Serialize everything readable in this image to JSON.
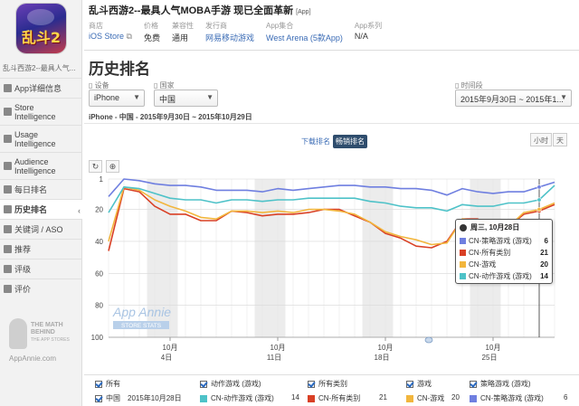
{
  "app": {
    "title": "乱斗西游2--最具人气MOBA手游 现已全面革新",
    "tag": "[App]",
    "icon_text": "乱斗2",
    "sidebar_name": "乱斗西游2--最具人气..."
  },
  "meta": [
    {
      "label": "商店",
      "value": "iOS Store",
      "link": true,
      "icon": "external-link-icon"
    },
    {
      "label": "价格",
      "value": "免费",
      "link": false
    },
    {
      "label": "兼容性",
      "value": "通用",
      "link": false
    },
    {
      "label": "发行商",
      "value": "网易移动游戏",
      "link": true
    },
    {
      "label": "App集合",
      "value": "West Arena (5款App)",
      "link": true
    },
    {
      "label": "App系列",
      "value": "N/A",
      "link": false
    }
  ],
  "nav": [
    {
      "label": "App详细信息",
      "icon": "info-icon"
    },
    {
      "label": "Store\nIntelligence",
      "icon": "store-icon",
      "tall": true
    },
    {
      "label": "Usage\nIntelligence",
      "icon": "usage-icon",
      "tall": true
    },
    {
      "label": "Audience\nIntelligence",
      "icon": "audience-icon",
      "tall": true
    },
    {
      "label": "每日排名",
      "icon": "list-icon"
    },
    {
      "label": "历史排名",
      "icon": "history-icon",
      "active": true
    },
    {
      "label": "关键词 / ASO",
      "icon": "key-icon"
    },
    {
      "label": "推荐",
      "icon": "feature-icon"
    },
    {
      "label": "评级",
      "icon": "star-icon"
    },
    {
      "label": "评价",
      "icon": "comment-icon"
    }
  ],
  "brand": {
    "line1": "THE MATH",
    "line2": "BEHIND",
    "line3": "THE APP STORES",
    "site": "AppAnnie.com"
  },
  "page_title": "历史排名",
  "filters": {
    "device_label": "设备",
    "device_value": "iPhone",
    "country_label": "国家",
    "country_value": "中国",
    "range_label": "时间段",
    "range_value": "2015年9月30日 ~ 2015年1..."
  },
  "subtitle": "iPhone - 中国 - 2015年9月30日 ~ 2015年10月29日",
  "rank_toggle": {
    "download": "下载排名",
    "grossing": "畅销排名"
  },
  "time_toggle": {
    "hour": "小时",
    "day": "天"
  },
  "tools": {
    "reset": "↻",
    "zoom": "⊕"
  },
  "watermark": {
    "name": "App Annie",
    "sub": "STORE STATS"
  },
  "chart_data": {
    "type": "line",
    "yaxis": {
      "ticks": [
        "1",
        "20",
        "40",
        "60",
        "80",
        "100"
      ],
      "reversed": true,
      "range": [
        1,
        100
      ]
    },
    "xaxis": {
      "ticks": [
        {
          "month": "10月",
          "day": "4日"
        },
        {
          "month": "10月",
          "day": "11日"
        },
        {
          "month": "10月",
          "day": "18日"
        },
        {
          "month": "10月",
          "day": "25日"
        }
      ]
    },
    "dates": [
      "9-30",
      "10-1",
      "10-2",
      "10-3",
      "10-4",
      "10-5",
      "10-6",
      "10-7",
      "10-8",
      "10-9",
      "10-10",
      "10-11",
      "10-12",
      "10-13",
      "10-14",
      "10-15",
      "10-16",
      "10-17",
      "10-18",
      "10-19",
      "10-20",
      "10-21",
      "10-22",
      "10-23",
      "10-24",
      "10-25",
      "10-26",
      "10-27",
      "10-28",
      "10-29"
    ],
    "series": [
      {
        "name": "CN-策略游戏 (游戏)",
        "color": "#6f7fe0",
        "values": [
          12,
          1,
          2,
          4,
          5,
          5,
          6,
          8,
          8,
          8,
          9,
          7,
          8,
          7,
          6,
          5,
          5,
          6,
          6,
          7,
          7,
          8,
          11,
          7,
          9,
          10,
          9,
          9,
          6,
          3
        ]
      },
      {
        "name": "CN-所有类别",
        "color": "#d94025",
        "values": [
          46,
          7,
          9,
          18,
          23,
          23,
          27,
          27,
          21,
          22,
          24,
          23,
          23,
          22,
          20,
          20,
          24,
          28,
          35,
          38,
          43,
          44,
          40,
          26,
          26,
          30,
          31,
          23,
          21,
          17
        ]
      },
      {
        "name": "CN-游戏",
        "color": "#f2b63d",
        "values": [
          40,
          6,
          8,
          14,
          18,
          21,
          25,
          26,
          21,
          21,
          22,
          21,
          22,
          20,
          20,
          21,
          23,
          28,
          34,
          37,
          39,
          42,
          41,
          26,
          27,
          29,
          31,
          22,
          20,
          16
        ]
      },
      {
        "name": "CN-动作游戏 (游戏)",
        "color": "#4ec2c8",
        "values": [
          22,
          6,
          7,
          10,
          13,
          14,
          14,
          16,
          14,
          14,
          15,
          14,
          14,
          13,
          13,
          13,
          13,
          15,
          16,
          18,
          19,
          19,
          21,
          17,
          18,
          18,
          16,
          16,
          14,
          5
        ]
      }
    ]
  },
  "tooltip": {
    "date": "周三, 10月28日",
    "rows": [
      {
        "name": "CN-策略游戏 (游戏)",
        "value": "6",
        "color": "#6f7fe0"
      },
      {
        "name": "CN-所有类别",
        "value": "21",
        "color": "#d94025"
      },
      {
        "name": "CN-游戏",
        "value": "20",
        "color": "#f2b63d"
      },
      {
        "name": "CN-动作游戏 (游戏)",
        "value": "14",
        "color": "#4ec2c8"
      }
    ]
  },
  "legend": {
    "header": [
      "所有",
      "动作游戏 (游戏)",
      "所有类别",
      "游戏",
      "策略游戏 (游戏)"
    ],
    "row_country": "中国",
    "row_date": "2015年10月28日",
    "items": [
      {
        "name": "CN-动作游戏 (游戏)",
        "value": "14",
        "color": "#4ec2c8"
      },
      {
        "name": "CN-所有类别",
        "value": "21",
        "color": "#d94025"
      },
      {
        "name": "CN-游戏",
        "value": "20",
        "color": "#f2b63d"
      },
      {
        "name": "CN-策略游戏 (游戏)",
        "value": "6",
        "color": "#6f7fe0"
      }
    ]
  }
}
